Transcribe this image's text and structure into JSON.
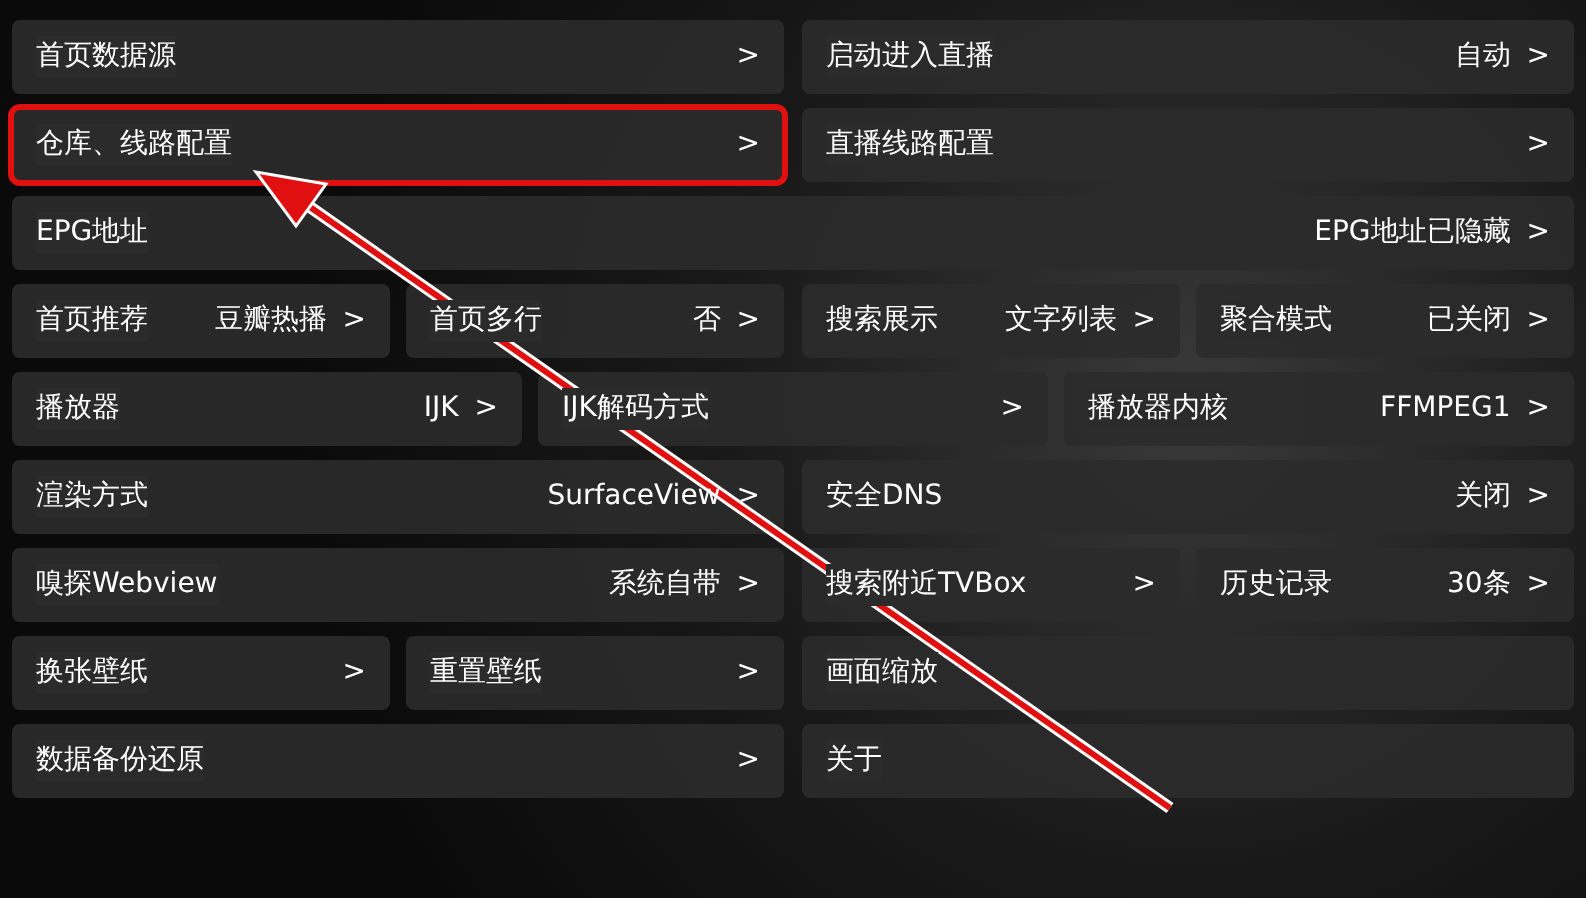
{
  "rows": [
    {
      "groups": [
        [
          {
            "label": "首页数据源",
            "arrow": ">",
            "annotated": false
          }
        ],
        [
          {
            "label": "启动进入直播",
            "value": "自动",
            "arrow": ">",
            "annotated": false
          }
        ]
      ]
    },
    {
      "groups": [
        [
          {
            "label": "仓库、线路配置",
            "arrow": ">",
            "annotated": true
          }
        ],
        [
          {
            "label": "直播线路配置",
            "arrow": ">",
            "annotated": false
          }
        ]
      ]
    },
    {
      "groups": [
        [
          {
            "label": "EPG地址",
            "value": "EPG地址已隐藏",
            "arrow": ">",
            "annotated": false
          }
        ]
      ]
    },
    {
      "groups": [
        [
          {
            "label": "首页推荐",
            "value": "豆瓣热播",
            "arrow": ">",
            "annotated": false
          },
          {
            "label": "首页多行",
            "value": "否",
            "arrow": ">",
            "annotated": false
          }
        ],
        [
          {
            "label": "搜索展示",
            "value": "文字列表",
            "arrow": ">",
            "annotated": false
          },
          {
            "label": "聚合模式",
            "value": "已关闭",
            "arrow": ">",
            "annotated": false
          }
        ]
      ]
    },
    {
      "groups": [
        [
          {
            "label": "播放器",
            "value": "IJK",
            "arrow": ">",
            "annotated": false
          },
          {
            "label": "IJK解码方式",
            "arrow": ">",
            "annotated": false
          },
          {
            "label": "播放器内核",
            "value": "FFMPEG1",
            "arrow": ">",
            "annotated": false
          }
        ]
      ]
    },
    {
      "groups": [
        [
          {
            "label": "渲染方式",
            "value": "SurfaceView",
            "arrow": ">",
            "annotated": false
          }
        ],
        [
          {
            "label": "安全DNS",
            "value": "关闭",
            "arrow": ">",
            "annotated": false
          }
        ]
      ]
    },
    {
      "groups": [
        [
          {
            "label": "嗅探Webview",
            "value": "系统自带",
            "arrow": ">",
            "annotated": false
          }
        ],
        [
          {
            "label": "搜索附近TVBox",
            "arrow": ">",
            "annotated": false
          },
          {
            "label": "历史记录",
            "value": "30条",
            "arrow": ">",
            "annotated": false
          }
        ]
      ]
    },
    {
      "groups": [
        [
          {
            "label": "换张壁纸",
            "arrow": ">",
            "annotated": false
          },
          {
            "label": "重置壁纸",
            "arrow": ">",
            "annotated": false
          }
        ],
        [
          {
            "label": "画面缩放",
            "annotated": false
          }
        ]
      ]
    },
    {
      "groups": [
        [
          {
            "label": "数据备份还原",
            "arrow": ">",
            "annotated": false
          }
        ],
        [
          {
            "label": "关于",
            "annotated": false
          }
        ]
      ]
    }
  ]
}
